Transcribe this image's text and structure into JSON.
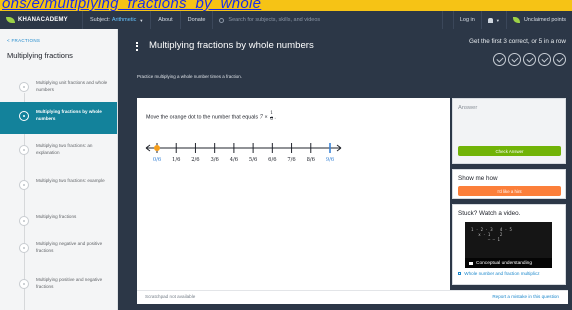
{
  "url_banner": "ons/e/multiplying_fractions_by_whole",
  "topbar": {
    "logo_text": "KHANACADEMY",
    "subject_label": "Subject:",
    "subject_value": "Arithmetic",
    "about": "About",
    "donate": "Donate",
    "search_placeholder": "Search for subjects, skills, and videos",
    "login": "Log in",
    "profile": "Unclaimed points"
  },
  "sidebar": {
    "back_label": "< FRACTIONS",
    "title": "Multiplying fractions",
    "items": [
      {
        "label": "Multiplying unit fractions and whole numbers",
        "active": false
      },
      {
        "label": "Multiplying fractions by whole numbers",
        "active": true
      },
      {
        "label": "Multiplying two fractions: an explanation",
        "active": false
      },
      {
        "label": "Multiplying two fractions: example",
        "active": false
      },
      {
        "label": "Multiplying fractions",
        "active": false
      },
      {
        "label": "Multiplying negative and positive fractions",
        "active": false
      },
      {
        "label": "Multiplying positive and negative fractions",
        "active": false
      }
    ]
  },
  "header": {
    "title": "Multiplying fractions by whole numbers",
    "description": "Practice multiplying a whole number times a fraction.",
    "goal": "Get the first 3 correct, or 5 in a row",
    "check_count": 5
  },
  "exercise": {
    "question_prefix": "Move the orange dot to the number that equals",
    "question_whole": "7",
    "question_times": "×",
    "question_num": "1",
    "question_den": "6",
    "question_suffix": ".",
    "number_line": {
      "ticks": [
        "0/6",
        "1/6",
        "2/6",
        "3/6",
        "4/6",
        "5/6",
        "6/6",
        "7/6",
        "8/6",
        "9/6"
      ],
      "orange_dot_index": 0,
      "blue_tick_index": 9,
      "orange_color": "#f59e1b",
      "blue_color": "#3a84d6"
    },
    "scratchpad": "Scratchpad not available",
    "report": "Report a mistake in this question"
  },
  "answer_panel": {
    "label": "Answer",
    "check_button": "Check Answer",
    "check_color": "#71b307"
  },
  "hint_panel": {
    "label": "Show me how",
    "hint_button": "I'd like a hint",
    "hint_color": "#fc7f3a"
  },
  "video_panel": {
    "label": "Stuck? Watch a video.",
    "thumb_caption": "Conceptual understanding",
    "link": "Whole number and fraction multiplicz"
  },
  "icons": {
    "logo": "leaf-icon",
    "search": "search-icon",
    "bell": "bell-icon",
    "profile": "leaf-avatar-icon",
    "exercise": "exercise-dots-icon",
    "check": "check-circle-icon",
    "video": "video-camera-icon"
  }
}
